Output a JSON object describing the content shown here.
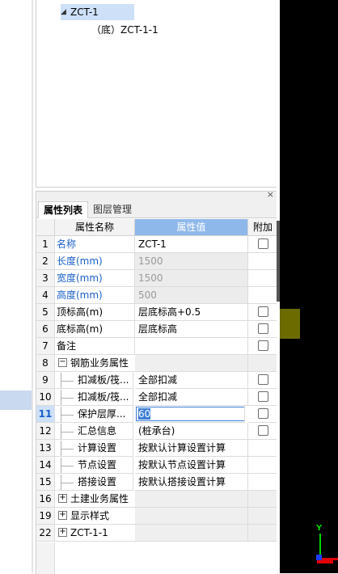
{
  "tree": {
    "root_label": "ZCT-1",
    "child_label": "（底）ZCT-1-1"
  },
  "panel": {
    "close_glyph": "×",
    "tabs": [
      {
        "label": "属性列表"
      },
      {
        "label": "图层管理"
      }
    ]
  },
  "grid": {
    "headers": {
      "name": "属性名称",
      "value": "属性值",
      "extra": "附加"
    },
    "rows": [
      {
        "num": "1",
        "name": "名称",
        "value": "ZCT-1"
      },
      {
        "num": "2",
        "name": "长度(mm)",
        "value": "1500"
      },
      {
        "num": "3",
        "name": "宽度(mm)",
        "value": "1500"
      },
      {
        "num": "4",
        "name": "高度(mm)",
        "value": "500"
      },
      {
        "num": "5",
        "name": "顶标高(m)",
        "value": "层底标高+0.5"
      },
      {
        "num": "6",
        "name": "底标高(m)",
        "value": "层底标高"
      },
      {
        "num": "7",
        "name": "备注",
        "value": ""
      },
      {
        "num": "8",
        "name": "钢筋业务属性",
        "value": ""
      },
      {
        "num": "9",
        "name": "扣减板/筏...",
        "value": "全部扣减"
      },
      {
        "num": "10",
        "name": "扣减板/筏...",
        "value": "全部扣减"
      },
      {
        "num": "11",
        "name": "保护层厚...",
        "value": "60"
      },
      {
        "num": "12",
        "name": "汇总信息",
        "value": "(桩承台)"
      },
      {
        "num": "13",
        "name": "计算设置",
        "value": "按默认计算设置计算"
      },
      {
        "num": "14",
        "name": "节点设置",
        "value": "按默认节点设置计算"
      },
      {
        "num": "15",
        "name": "搭接设置",
        "value": "按默认搭接设置计算"
      },
      {
        "num": "16",
        "name": "土建业务属性",
        "value": ""
      },
      {
        "num": "19",
        "name": "显示样式",
        "value": ""
      },
      {
        "num": "22",
        "name": "ZCT-1-1",
        "value": ""
      }
    ]
  },
  "viewport": {
    "axis_y_label": "Y"
  },
  "colors": {
    "header_value_bg": "#8fb8ea",
    "blue_text": "#1a5fc8",
    "selection": "#cde0f7",
    "axis_y": "#00d400",
    "axis_x": "#e00000",
    "olive": "#6b6b00"
  }
}
